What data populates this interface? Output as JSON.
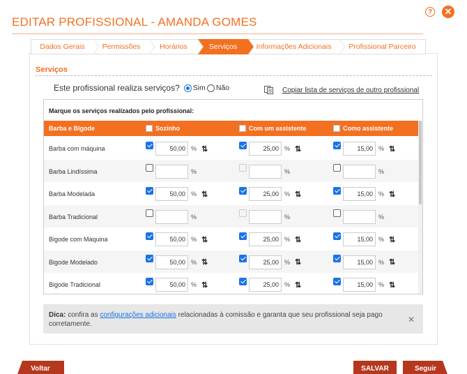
{
  "title": "EDITAR PROFISSIONAL - AMANDA GOMES",
  "top_icons": {
    "help": "?",
    "close": "✕"
  },
  "tabs": [
    {
      "label": "Dados Gerais",
      "active": false
    },
    {
      "label": "Permissões",
      "active": false
    },
    {
      "label": "Horários",
      "active": false
    },
    {
      "label": "Serviços",
      "active": true
    },
    {
      "label": "Informações Adicionais",
      "active": false
    },
    {
      "label": "Profissional Parceiro",
      "active": false
    }
  ],
  "section_title": "Serviços",
  "question": {
    "text": "Este profissional realiza serviços?",
    "option_yes": "Sim",
    "option_no": "Não",
    "selected": "Sim"
  },
  "copy_link": "Copiar lista de serviços de outro profissional",
  "table": {
    "note": "Marque os serviços realizados pelo profissional:",
    "headers": {
      "service": "Barba e Bigode",
      "alone": "Sozinho",
      "with_assistant": "Com um assistente",
      "as_assistant": "Como assistente"
    },
    "percent_symbol": "%",
    "sort_symbol": "⇅",
    "rows": [
      {
        "name": "Barba com máquina",
        "alone": {
          "checked": true,
          "value": "50,00"
        },
        "with": {
          "checked": true,
          "value": "25,00"
        },
        "as": {
          "checked": true,
          "value": "15,00"
        }
      },
      {
        "name": "Barba Lindíssima",
        "alone": {
          "checked": false,
          "value": ""
        },
        "with": {
          "checked": false,
          "disabled": true,
          "value": ""
        },
        "as": {
          "checked": false,
          "value": ""
        }
      },
      {
        "name": "Barba Modelada",
        "alone": {
          "checked": true,
          "value": "50,00"
        },
        "with": {
          "checked": true,
          "value": "25,00"
        },
        "as": {
          "checked": true,
          "value": "15,00"
        }
      },
      {
        "name": "Barba Tradicional",
        "alone": {
          "checked": false,
          "value": ""
        },
        "with": {
          "checked": false,
          "disabled": true,
          "value": ""
        },
        "as": {
          "checked": false,
          "value": ""
        }
      },
      {
        "name": "Bigode com Máquina",
        "alone": {
          "checked": true,
          "value": "50,00"
        },
        "with": {
          "checked": true,
          "value": "25,00"
        },
        "as": {
          "checked": true,
          "value": "15,00"
        }
      },
      {
        "name": "Bigode Modelado",
        "alone": {
          "checked": true,
          "value": "50,00"
        },
        "with": {
          "checked": true,
          "value": "25,00"
        },
        "as": {
          "checked": true,
          "value": "15,00"
        }
      },
      {
        "name": "Bigode Tradicional",
        "alone": {
          "checked": true,
          "value": "50,00"
        },
        "with": {
          "checked": true,
          "value": "25,00"
        },
        "as": {
          "checked": true,
          "value": "15,00"
        }
      }
    ]
  },
  "tip": {
    "label": "Dica:",
    "text_before": "confira as",
    "link": "configurações adicionais",
    "text_after": "relacionadas à comissão e garanta que seu profissional seja pago corretamente.",
    "close": "✕"
  },
  "buttons": {
    "back": "Voltar",
    "save": "SALVAR",
    "next": "Seguir"
  }
}
